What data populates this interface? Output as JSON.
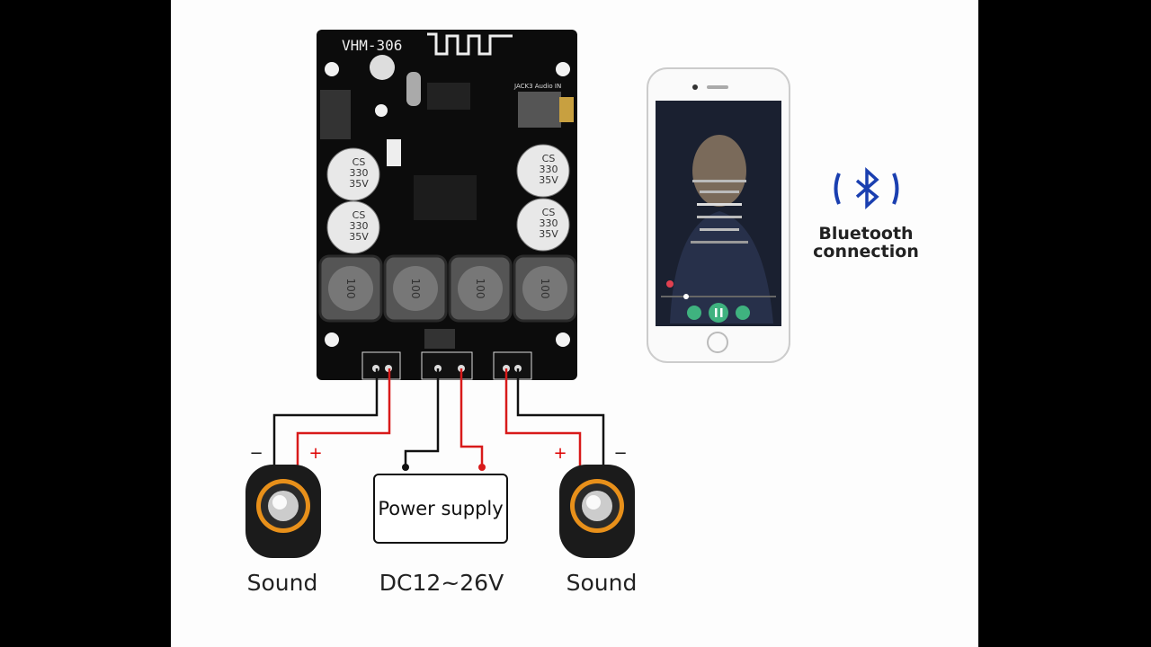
{
  "board": {
    "model": "VHM-306",
    "jack_label": "JACK3 Audio IN",
    "capacitor_label": [
      "CS",
      "330",
      "35V"
    ],
    "inductor_label": "100"
  },
  "phone": {
    "screen": "music-player"
  },
  "bluetooth": {
    "icon": "bluetooth-icon",
    "line1": "Bluetooth",
    "line2": "connection",
    "color": "#1a3fb0"
  },
  "power_supply": {
    "label": "Power supply",
    "voltage": "DC12~26V"
  },
  "speakers": [
    {
      "label": "Sound",
      "minus": "−",
      "plus": "+"
    },
    {
      "label": "Sound",
      "minus": "−",
      "plus": "+"
    }
  ],
  "colors": {
    "wire_positive": "#d81a1a",
    "wire_negative": "#111111",
    "speaker_ring": "#e8901a"
  }
}
